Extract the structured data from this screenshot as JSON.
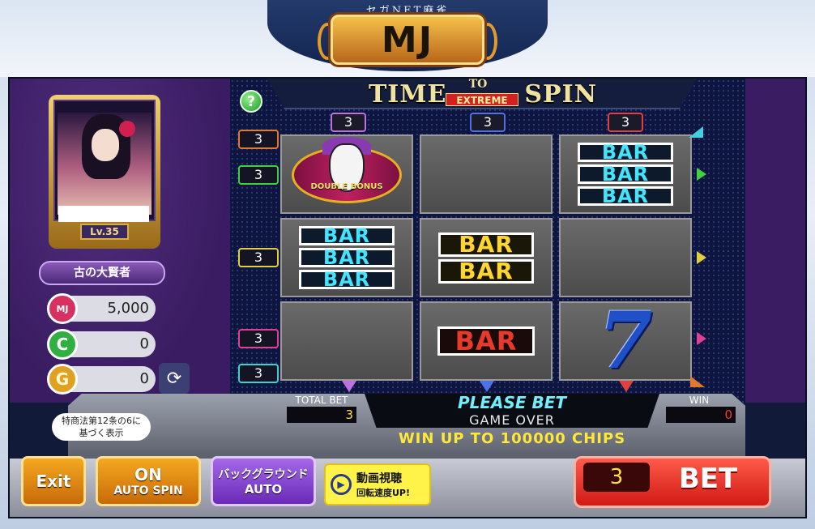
{
  "header": {
    "site_name": "セガNET麻雀",
    "logo": "MJ"
  },
  "game_title": {
    "time": "TIME",
    "to": "TO",
    "extreme": "EXTREME",
    "spin": "SPIN"
  },
  "help_label": "?",
  "player": {
    "level": "Lv.35",
    "title_badge": "古の大賢者",
    "mj_points": "5,000",
    "coins": "0",
    "gold": "0",
    "icons": {
      "mj": "MJ",
      "coin": "C",
      "gold": "G"
    }
  },
  "reels": {
    "column_bets": [
      "3",
      "3",
      "3"
    ],
    "cells": [
      [
        "double-bonus-joker",
        "blank",
        "triple-bar"
      ],
      [
        "triple-bar",
        "double-bar",
        "blank"
      ],
      [
        "blank",
        "single-bar",
        "seven"
      ]
    ],
    "symbol_text": {
      "bar": "BAR",
      "seven": "7",
      "double": "DOUBLE",
      "bonus": "BONUS"
    },
    "line_tags_left": [
      "3",
      "3",
      "3",
      "3",
      "3"
    ]
  },
  "info": {
    "total_bet_label": "TOTAL BET",
    "total_bet_value": "3",
    "message_primary": "PLEASE BET",
    "message_secondary": "GAME OVER",
    "win_label": "WIN",
    "win_value": "0",
    "promo": "WIN UP TO 100000 CHIPS"
  },
  "legal_note": {
    "line1": "特商法第12条の6に",
    "line2": "基づく表示"
  },
  "buttons": {
    "exit": "Exit",
    "auto_spin_state": "ON",
    "auto_spin_label": "AUTO SPIN",
    "background_label": "バックグラウンド",
    "background_value": "AUTO",
    "video_line1": "動画視聴",
    "video_line2": "回転速度UP!",
    "bet_count": "3",
    "bet_label": "BET"
  },
  "colors": {
    "cyan_bar": "#44e4ff",
    "yellow_bar": "#ffd630",
    "red_bar": "#e83a2a",
    "seven_blue": "#2050c8",
    "please_bet": "#70f0ff",
    "promo_yellow": "#ffe838"
  }
}
